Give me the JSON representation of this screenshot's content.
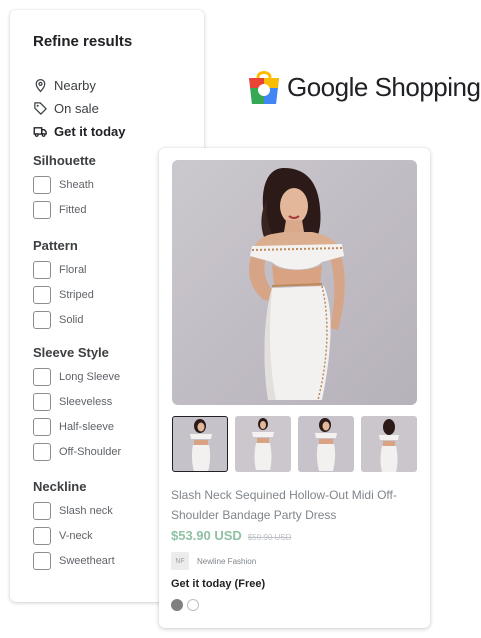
{
  "filters": {
    "title": "Refine results",
    "quick": [
      {
        "label": "Nearby",
        "icon": "location-pin-icon"
      },
      {
        "label": "On sale",
        "icon": "tag-icon"
      },
      {
        "label": "Get it today",
        "icon": "truck-icon"
      }
    ],
    "sections": [
      {
        "title": "Silhouette",
        "options": [
          "Sheath",
          "Fitted"
        ]
      },
      {
        "title": "Pattern",
        "options": [
          "Floral",
          "Striped",
          "Solid"
        ]
      },
      {
        "title": "Sleeve Style",
        "options": [
          "Long Sleeve",
          "Sleeveless",
          "Half-sleeve",
          "Off-Shoulder"
        ]
      },
      {
        "title": "Neckline",
        "options": [
          "Slash neck",
          "V-neck",
          "Sweetheart"
        ]
      }
    ]
  },
  "logo": {
    "text": "Google Shopping",
    "icon": "google-shopping-bag-icon"
  },
  "product": {
    "title": "Slash Neck Sequined Hollow-Out Midi Off-Shoulder Bandage Party Dress",
    "price": "$53.90 USD",
    "old_price": "$59.90 USD",
    "seller_initials": "NF",
    "seller_name": "Newline Fashion",
    "delivery": "Get it today (Free)",
    "swatches": [
      {
        "color": "#808080",
        "selected": true
      },
      {
        "color": "#ffffff",
        "selected": false
      }
    ]
  },
  "colors": {
    "price": "#8fc1a4",
    "accent": "#202124"
  }
}
